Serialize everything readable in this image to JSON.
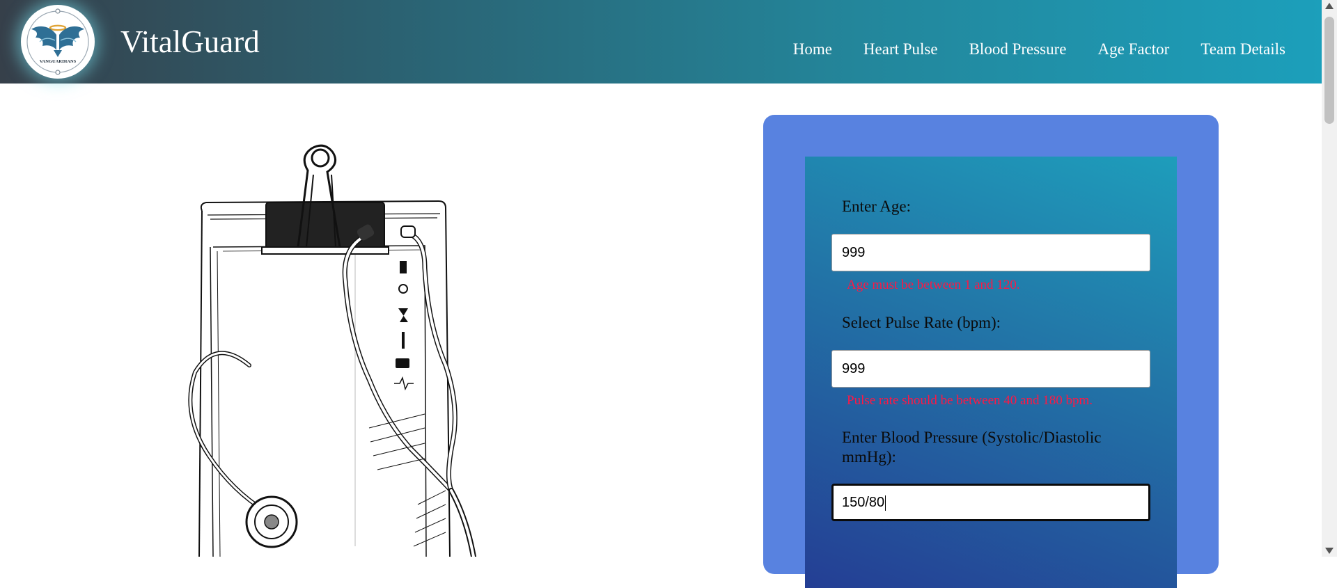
{
  "header": {
    "brand": "VitalGuard",
    "logo_text": "VANGUARDIANS",
    "nav": [
      "Home",
      "Heart Pulse",
      "Blood Pressure",
      "Age Factor",
      "Team Details"
    ]
  },
  "form": {
    "age_label": "Enter Age:",
    "age_value": "999",
    "age_error": "Age must be between 1 and 120.",
    "pulse_label": "Select Pulse Rate (bpm):",
    "pulse_value": "999",
    "pulse_error": "Pulse rate should be between 40 and 180 bpm.",
    "bp_label_line1": "Enter Blood Pressure (Systolic/Diastolic",
    "bp_label_line2": "mmHg):",
    "bp_value": "150/80"
  },
  "colors": {
    "card_bg": "#5882e0",
    "error": "#ff1744",
    "header_start": "#36404a",
    "header_end": "#1c9fbb"
  },
  "icons": [
    "angel-wings-logo-icon",
    "stethoscope-clipboard-illustration",
    "scroll-up-icon",
    "scroll-down-icon"
  ]
}
